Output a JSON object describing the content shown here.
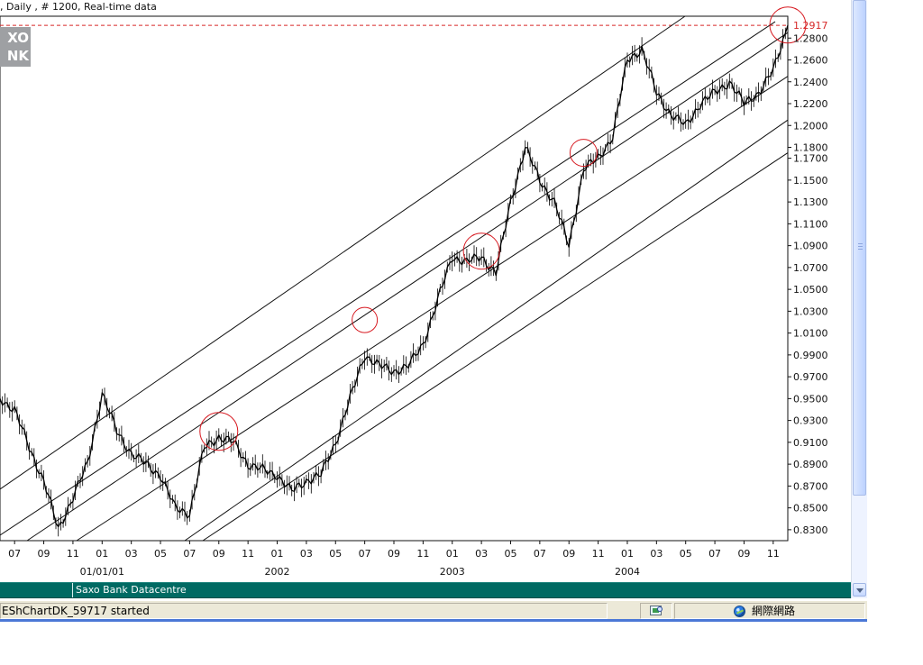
{
  "window": {
    "title": ", Daily , # 1200, Real-time data"
  },
  "logo": {
    "line1": "XO",
    "line2": "NK"
  },
  "chart_data": {
    "type": "line",
    "title": ", Daily , # 1200, Real-time data",
    "current_price": "1.2917",
    "y_ticks": [
      "1.2800",
      "1.2600",
      "1.2400",
      "1.2200",
      "1.2000",
      "1.1800",
      "1.1700",
      "1.1500",
      "1.1300",
      "1.1100",
      "1.0900",
      "1.0700",
      "1.0500",
      "1.0300",
      "1.0100",
      "0.9900",
      "0.9700",
      "0.9500",
      "0.9300",
      "0.9100",
      "0.8900",
      "0.8700",
      "0.8500",
      "0.8300"
    ],
    "x_month_ticks": [
      "07",
      "09",
      "11",
      "01",
      "03",
      "05",
      "07",
      "09",
      "11",
      "01",
      "03",
      "05",
      "07",
      "09",
      "11",
      "01",
      "03",
      "05",
      "07",
      "09",
      "11",
      "01",
      "03",
      "05",
      "07",
      "09",
      "11"
    ],
    "x_year_labels": [
      "01/01/01",
      "2002",
      "2003",
      "2004"
    ],
    "xlim": [
      "2000-06",
      "2004-12"
    ],
    "ylim": [
      0.82,
      1.3
    ],
    "series": [
      {
        "x": [
          "2000-06",
          "2000-07",
          "2000-08",
          "2000-09",
          "2000-10",
          "2000-11",
          "2000-12",
          "2001-01",
          "2001-02",
          "2001-03",
          "2001-04",
          "2001-05",
          "2001-06",
          "2001-07",
          "2001-08",
          "2001-09",
          "2001-10",
          "2001-11",
          "2001-12",
          "2002-01",
          "2002-02",
          "2002-03",
          "2002-04",
          "2002-05",
          "2002-06",
          "2002-07",
          "2002-08",
          "2002-09",
          "2002-10",
          "2002-11",
          "2002-12",
          "2003-01",
          "2003-02",
          "2003-03",
          "2003-04",
          "2003-05",
          "2003-06",
          "2003-07",
          "2003-08",
          "2003-09",
          "2003-10",
          "2003-11",
          "2003-12",
          "2004-01",
          "2004-02",
          "2004-03",
          "2004-04",
          "2004-05",
          "2004-06",
          "2004-07",
          "2004-08",
          "2004-09",
          "2004-10",
          "2004-11",
          "2004-12"
        ],
        "values": [
          0.95,
          0.94,
          0.905,
          0.875,
          0.83,
          0.86,
          0.89,
          0.955,
          0.92,
          0.9,
          0.89,
          0.88,
          0.85,
          0.845,
          0.905,
          0.915,
          0.91,
          0.89,
          0.885,
          0.88,
          0.865,
          0.875,
          0.88,
          0.91,
          0.95,
          0.99,
          0.98,
          0.975,
          0.98,
          1.0,
          1.04,
          1.08,
          1.075,
          1.08,
          1.065,
          1.13,
          1.18,
          1.15,
          1.13,
          1.09,
          1.16,
          1.17,
          1.19,
          1.26,
          1.27,
          1.23,
          1.21,
          1.2,
          1.22,
          1.23,
          1.24,
          1.22,
          1.23,
          1.25,
          1.2917
        ]
      }
    ],
    "annotation_circles": 6,
    "trend_channels": 6,
    "grid": "off"
  },
  "bottom_bar": {
    "label": "Saxo Bank Datacentre"
  },
  "status_bar": {
    "message": "EShChartDK_59717 started",
    "network_label": "網際網路"
  }
}
